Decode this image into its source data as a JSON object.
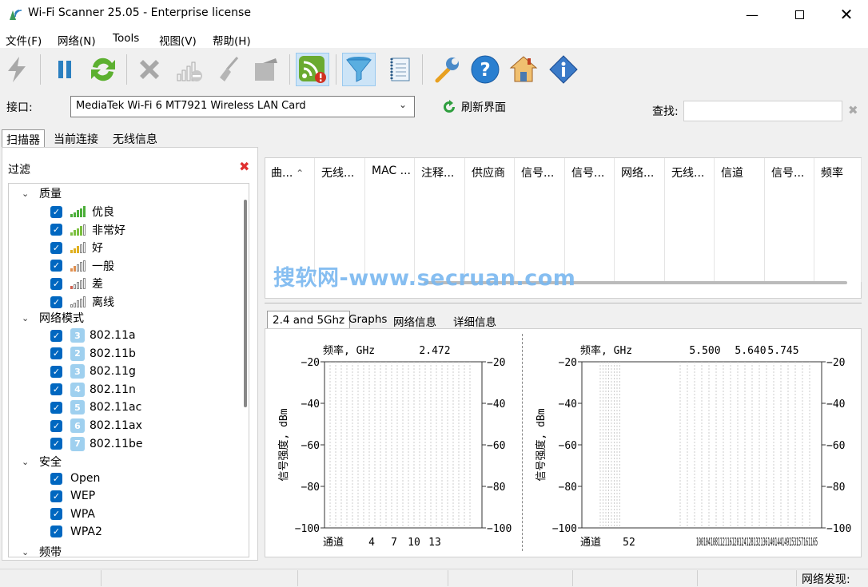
{
  "window": {
    "title": "Wi-Fi Scanner 25.05 - Enterprise license"
  },
  "menu": [
    "文件(F)",
    "网络(N)",
    "Tools",
    "视图(V)",
    "帮助(H)"
  ],
  "toolbar": {
    "icons": [
      "lightning-icon",
      "pause-icon",
      "refresh-icon",
      "delete-icon",
      "signal-remove-icon",
      "broom-icon",
      "export-icon",
      "wifi-alert-icon",
      "filter-icon",
      "notebook-icon",
      "wrench-icon",
      "help-icon",
      "home-icon",
      "info-icon"
    ],
    "active": [
      "wifi-alert-icon",
      "filter-icon"
    ]
  },
  "interface": {
    "label": "接口:",
    "value": "MediaTek Wi-Fi 6 MT7921 Wireless LAN Card",
    "refresh_label": "刷新界面",
    "find_label": "查找:",
    "find_value": ""
  },
  "main_tabs": [
    "扫描器",
    "当前连接",
    "无线信息"
  ],
  "filter": {
    "title": "过滤",
    "groups": {
      "quality": {
        "label": "质量",
        "items": [
          "优良",
          "非常好",
          "好",
          "一般",
          "差",
          "离线"
        ],
        "levels": [
          5,
          4,
          3,
          2,
          1,
          0
        ]
      },
      "mode": {
        "label": "网络模式",
        "items": [
          "802.11a",
          "802.11b",
          "802.11g",
          "802.11n",
          "802.11ac",
          "802.11ax",
          "802.11be"
        ],
        "badges": [
          "3",
          "2",
          "3",
          "4",
          "5",
          "6",
          "7"
        ]
      },
      "security": {
        "label": "安全",
        "items": [
          "Open",
          "WEP",
          "WPA",
          "WPA2"
        ]
      },
      "band": {
        "label": "频带"
      }
    }
  },
  "table": {
    "columns": [
      "曲...",
      "无线...",
      "MAC ...",
      "注释...",
      "供应商",
      "信号...",
      "信号...",
      "网络...",
      "无线...",
      "信道",
      "信号...",
      "频率"
    ],
    "sorted_column": "曲..."
  },
  "watermark": "搜软网-www.secruan.com",
  "lower_tabs": [
    "2.4 and 5Ghz",
    "Graphs",
    "网络信息",
    "详细信息"
  ],
  "charts": {
    "freq_label": "频率, GHz",
    "y_label": "信号强度, dBm",
    "channel_label": "通道",
    "y_ticks": [
      "−20",
      "−40",
      "−60",
      "−80",
      "−100"
    ],
    "band24": {
      "freqs": [
        "2.472"
      ],
      "channels": [
        "4",
        "7",
        "10",
        "13"
      ]
    },
    "band5": {
      "freqs": [
        "5.500",
        "5.640",
        "5.745"
      ],
      "channels": [
        "52"
      ],
      "channel_overlap": "100104108112116120124128132136140144149153157161165"
    }
  },
  "status": {
    "networks_found_label": "网络发现:"
  }
}
